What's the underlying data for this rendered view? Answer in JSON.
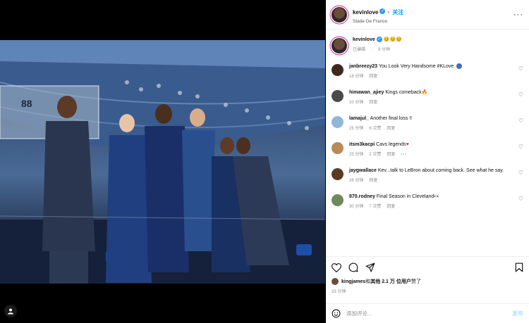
{
  "post": {
    "username": "kevinlove",
    "follow_label": "关注",
    "location": "Stade De France",
    "more_label": "···"
  },
  "caption": {
    "username": "kevinlove",
    "text": "",
    "status": "已编辑",
    "time": "9 分钟"
  },
  "comments": [
    {
      "username": "janbreezy23",
      "text": "You Look Very Handsome #KLove",
      "time": "18 分钟",
      "likes": "",
      "reply": "回复",
      "avatar_color": "#3d2a1e"
    },
    {
      "username": "himawan_ajiey",
      "text": "Kings comeback",
      "time": "10 分钟",
      "likes": "",
      "reply": "回复",
      "avatar_color": "#4a4a4a"
    },
    {
      "username": "lamajul_",
      "text": "Another final loss !!",
      "time": "25 分钟",
      "likes": "6 次赞",
      "reply": "回复",
      "avatar_color": "#8fb7d8"
    },
    {
      "username": "itsm3kacpi",
      "text": "Cavs legends",
      "time": "25 分钟",
      "likes": "2 次赞",
      "reply": "回复",
      "avatar_color": "#b98a57"
    },
    {
      "username": "jaygwallace",
      "text": "Kev...talk to LeBron about coming back. See what he say.",
      "time": "26 分钟",
      "likes": "",
      "reply": "回复",
      "avatar_color": "#5b3a24"
    },
    {
      "username": "870.rodney",
      "text": "Final Season in Cleveland",
      "time": "30 分钟",
      "likes": "7 次赞",
      "reply": "回复",
      "avatar_color": "#6e8a5a"
    }
  ],
  "likes_line": {
    "prefix": "kingjames",
    "middle": " 和 ",
    "bold": "其他 2.1 万 位用户",
    "suffix": " 赞了"
  },
  "post_time": "33 分钟",
  "add_comment": {
    "placeholder": "添加评论...",
    "post_label": "发布"
  },
  "colors": {
    "accent": "#0095f6",
    "verified": "#3897f0",
    "muted": "#8e8e8e"
  }
}
